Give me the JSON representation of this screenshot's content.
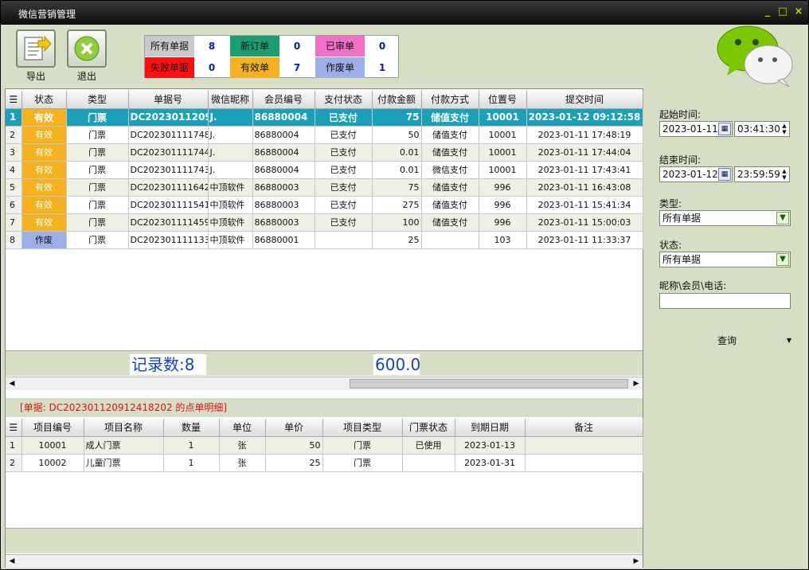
{
  "window": {
    "title": "微信营销管理",
    "btn_min": "_",
    "btn_max": "□",
    "btn_close": "×"
  },
  "toolbar": {
    "export_label": "导出",
    "exit_label": "退出"
  },
  "stats": [
    {
      "label": "所有单据",
      "value": "8",
      "bg": "#c9c9c9",
      "fg": "#111"
    },
    {
      "label": "新订单",
      "value": "0",
      "bg": "#1aa070",
      "fg": "#111"
    },
    {
      "label": "已审单",
      "value": "0",
      "bg": "#f070c8",
      "fg": "#111"
    },
    {
      "label": "失败单据",
      "value": "0",
      "bg": "#ff1010",
      "fg": "#111"
    },
    {
      "label": "有效单",
      "value": "7",
      "bg": "#f3b21e",
      "fg": "#111"
    },
    {
      "label": "作废单",
      "value": "1",
      "bg": "#9bb0e8",
      "fg": "#111"
    }
  ],
  "orders": {
    "columns": [
      "",
      "状态",
      "类型",
      "单据号",
      "微信昵称",
      "会员编号",
      "支付状态",
      "付款金额",
      "付款方式",
      "位置号",
      "提交时间"
    ],
    "rows": [
      [
        "1",
        "有效",
        "门票",
        "DC20230112091",
        "J.",
        "86880004",
        "已支付",
        "75",
        "储值支付",
        "10001",
        "2023-01-12 09:12:58"
      ],
      [
        "2",
        "有效",
        "门票",
        "DC2023011117481",
        "J.",
        "86880004",
        "已支付",
        "50",
        "储值支付",
        "10001",
        "2023-01-11 17:48:19"
      ],
      [
        "3",
        "有效",
        "门票",
        "DC2023011117440",
        "J.",
        "86880004",
        "已支付",
        "0.01",
        "储值支付",
        "10001",
        "2023-01-11 17:44:04"
      ],
      [
        "4",
        "有效",
        "门票",
        "DC2023011117433",
        "J.",
        "86880004",
        "已支付",
        "0.01",
        "微信支付",
        "10001",
        "2023-01-11 17:43:41"
      ],
      [
        "5",
        "有效",
        "门票",
        "DC2023011116425",
        "中顶软件",
        "86880003",
        "已支付",
        "75",
        "储值支付",
        "996",
        "2023-01-11 16:43:08"
      ],
      [
        "6",
        "有效",
        "门票",
        "DC2023011115412",
        "中顶软件",
        "86880003",
        "已支付",
        "275",
        "储值支付",
        "996",
        "2023-01-11 15:41:34"
      ],
      [
        "7",
        "有效",
        "门票",
        "DC2023011114595",
        "中顶软件",
        "86880003",
        "已支付",
        "100",
        "储值支付",
        "996",
        "2023-01-11 15:00:03"
      ],
      [
        "8",
        "作废",
        "门票",
        "DC2023011111333",
        "中顶软件",
        "86880001",
        "",
        "25",
        "",
        "103",
        "2023-01-11 11:33:37"
      ]
    ],
    "record_count": "记录数:8",
    "total_amount": "600.0"
  },
  "detail": {
    "title": "[单据: DC202301120912418202 的点单明细]",
    "columns": [
      "",
      "项目编号",
      "项目名称",
      "数量",
      "单位",
      "单价",
      "项目类型",
      "门票状态",
      "到期日期",
      "备注"
    ],
    "rows": [
      [
        "1",
        "10001",
        "成人门票",
        "1",
        "张",
        "50",
        "门票",
        "已使用",
        "2023-01-13",
        ""
      ],
      [
        "2",
        "10002",
        "儿童门票",
        "1",
        "张",
        "25",
        "门票",
        "",
        "2023-01-31",
        ""
      ]
    ]
  },
  "filters": {
    "start_label": "起始时间:",
    "start_date": "2023-01-11",
    "start_time": "03:41:30",
    "end_label": "结束时间:",
    "end_date": "2023-01-12",
    "end_time": "23:59:59",
    "type_label": "类型:",
    "type_value": "所有单据",
    "status_label": "状态:",
    "status_value": "所有单据",
    "search_label": "昵称\\会员\\电话:",
    "search_value": "",
    "query_label": "查询"
  }
}
